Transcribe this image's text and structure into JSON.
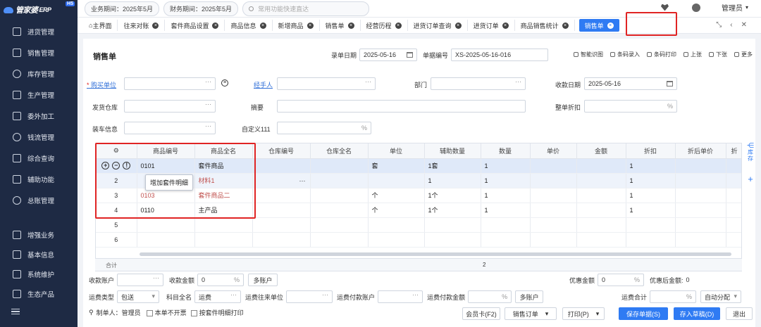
{
  "app": {
    "logo": "管家婆",
    "logo_sub": "ERP",
    "badge": "H5"
  },
  "sidebar": {
    "items": [
      {
        "label": "进货管理",
        "icon": "cart-icon"
      },
      {
        "label": "销售管理",
        "icon": "sales-icon"
      },
      {
        "label": "库存管理",
        "icon": "warehouse-icon"
      },
      {
        "label": "生产管理",
        "icon": "factory-icon"
      },
      {
        "label": "委外加工",
        "icon": "outsource-icon"
      },
      {
        "label": "钱流管理",
        "icon": "money-icon"
      },
      {
        "label": "综合查询",
        "icon": "query-icon"
      },
      {
        "label": "辅助功能",
        "icon": "assist-icon"
      },
      {
        "label": "总账管理",
        "icon": "ledger-icon"
      }
    ],
    "items2": [
      {
        "label": "增强业务",
        "icon": "enhance-icon"
      },
      {
        "label": "基本信息",
        "icon": "info-icon"
      },
      {
        "label": "系统维护",
        "icon": "maintain-icon"
      },
      {
        "label": "生态产品",
        "icon": "eco-icon"
      }
    ]
  },
  "topbar": {
    "business_period": "业务期间：2025年5月",
    "finance_period": "财务期间：2025年5月",
    "search_placeholder": "常用功能快速直达",
    "user": "管理员"
  },
  "tabs": [
    {
      "label": "主界面"
    },
    {
      "label": "往来对账"
    },
    {
      "label": "套件商品设置"
    },
    {
      "label": "商品信息"
    },
    {
      "label": "新增商品"
    },
    {
      "label": "销售单"
    },
    {
      "label": "经营历程"
    },
    {
      "label": "进货订单查询"
    },
    {
      "label": "进货订单"
    },
    {
      "label": "商品销售统计"
    },
    {
      "label": "销售单",
      "active": true
    }
  ],
  "form": {
    "title": "销售单",
    "entry_date_label": "录单日期",
    "entry_date": "2025-05-16",
    "doc_no_label": "单据编号",
    "doc_no": "XS-2025-05-16-016",
    "toolbar": [
      "智能识图",
      "条码录入",
      "条码打印",
      "上张",
      "下张",
      "更多"
    ],
    "buyer_label": "购买单位",
    "handler_label": "经手人",
    "dept_label": "部门",
    "receive_date_label": "收款日期",
    "receive_date": "2025-05-16",
    "ship_wh_label": "发货仓库",
    "summary_label": "摘要",
    "discount_label": "整单折扣",
    "loading_label": "装车信息",
    "custom_label": "自定义111"
  },
  "grid": {
    "columns": [
      "商品编号",
      "商品全名",
      "仓库编号",
      "仓库全名",
      "单位",
      "辅助数量",
      "数量",
      "单价",
      "金额",
      "折扣",
      "折后单价",
      "折"
    ],
    "rows": [
      {
        "no": "1",
        "code": "0101",
        "name": "套件商品",
        "unit": "套",
        "aux": "1套",
        "qty": "1",
        "disc": "1"
      },
      {
        "no": "2",
        "code": "0102",
        "name": "材料1",
        "unit": "",
        "aux": "1",
        "qty": "1",
        "disc": "1"
      },
      {
        "no": "3",
        "code": "0103",
        "name": "套件商品二",
        "unit": "个",
        "aux": "1个",
        "qty": "1",
        "disc": "1"
      },
      {
        "no": "4",
        "code": "0110",
        "name": "主产品",
        "unit": "个",
        "aux": "1个",
        "qty": "1",
        "disc": "1"
      },
      {
        "no": "5",
        "code": "",
        "name": "",
        "unit": "",
        "aux": "",
        "qty": "",
        "disc": ""
      },
      {
        "no": "6",
        "code": "",
        "name": "",
        "unit": "",
        "aux": "",
        "qty": "",
        "disc": ""
      }
    ],
    "tooltip": "增加套件明细",
    "sum_label": "合计",
    "sum_qty": "2",
    "side_label": "库存"
  },
  "footer": {
    "receive_account": "收款账户",
    "receive_amount": "收款金额",
    "receive_amount_value": "0",
    "multi_account": "多账户",
    "discount_amount": "优惠金额",
    "discount_value": "0",
    "after_discount": "优惠后金额:",
    "after_discount_value": "0",
    "freight_type": "运费类型",
    "freight_type_value": "包送",
    "subject": "科目全名",
    "subject_value": "运费",
    "freight_unit": "运费往来单位",
    "freight_account": "运费付款账户",
    "freight_amount": "运费付款金额",
    "freight_total": "运费合计",
    "auto_alloc": "自动分配",
    "maker": "制单人：管理员",
    "no_invoice": "本单不开票",
    "print_by_kit": "按套件明细打印",
    "buttons": [
      "会员卡(F2)",
      "销售订单",
      "打印(P)",
      "保存单据(S)",
      "存入草稿(D)",
      "退出"
    ]
  }
}
